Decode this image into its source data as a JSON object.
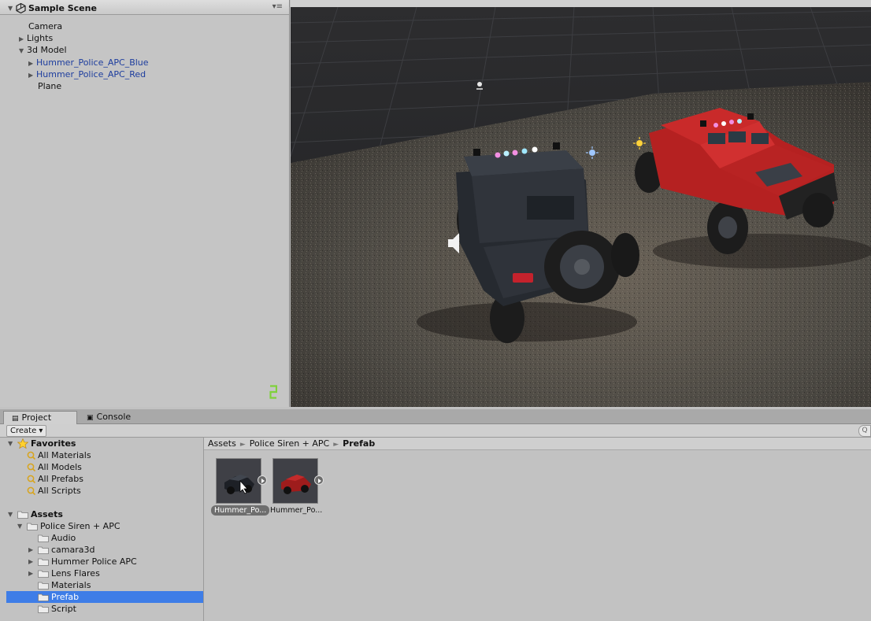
{
  "hierarchy": {
    "scene_title": "Sample Scene",
    "items": [
      {
        "label": "Camera"
      },
      {
        "label": "Lights"
      },
      {
        "label": "3d Model"
      },
      {
        "label": "Hummer_Police_APC_Blue"
      },
      {
        "label": "Hummer_Police_APC_Red"
      },
      {
        "label": "Plane"
      }
    ]
  },
  "scene_view": {
    "objects": [
      "camera-gizmo-icon",
      "light-gizmo-icon",
      "audio-source-icon",
      "black-hummer-apc",
      "red-hummer-apc"
    ]
  },
  "tabs": [
    {
      "label": "Project",
      "icon": "project-icon"
    },
    {
      "label": "Console",
      "icon": "console-icon"
    }
  ],
  "toolbar": {
    "create_label": "Create",
    "create_arrow": "▾"
  },
  "favorites": {
    "title": "Favorites",
    "items": [
      {
        "label": "All Materials"
      },
      {
        "label": "All Models"
      },
      {
        "label": "All Prefabs"
      },
      {
        "label": "All Scripts"
      }
    ]
  },
  "assets_tree": {
    "title": "Assets",
    "items": [
      {
        "label": "Police Siren + APC"
      },
      {
        "label": "Audio"
      },
      {
        "label": "camara3d"
      },
      {
        "label": "Hummer Police APC"
      },
      {
        "label": "Lens Flares"
      },
      {
        "label": "Materials"
      },
      {
        "label": "Prefab"
      },
      {
        "label": "Script"
      }
    ]
  },
  "breadcrumb": {
    "parts": [
      "Assets",
      "Police Siren + APC",
      "Prefab"
    ],
    "separator": "►"
  },
  "assets": [
    {
      "label": "Hummer_Po...",
      "selected": true
    },
    {
      "label": "Hummer_Po...",
      "selected": false
    }
  ],
  "colors": {
    "selection": "#3e7de7",
    "prefab_blue_text": "#1d3d9e",
    "scene_background": "#2b2b2c"
  }
}
